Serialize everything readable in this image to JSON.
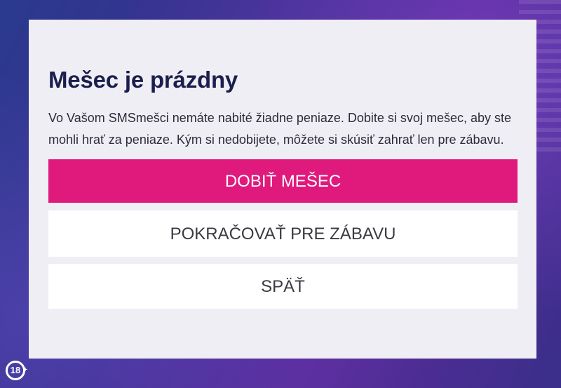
{
  "dialog": {
    "title": "Mešec je prázdny",
    "message": "Vo Vašom SMSmešci nemáte nabité žiadne peniaze. Dobite si svoj mešec, aby ste mohli hrať za peniaze. Kým si nedobijete, môžete si skúsiť zahrať len pre zábavu.",
    "buttons": {
      "top_up": "DOBIŤ MEŠEC",
      "play_for_fun": "POKRAČOVAŤ PRE ZÁBAVU",
      "back": "SPÄŤ"
    }
  },
  "age_badge": {
    "label": "18",
    "plus": "+"
  },
  "colors": {
    "primary_button": "#e0197d",
    "dialog_background": "#f0eef5",
    "title_color": "#1b1f4e"
  }
}
